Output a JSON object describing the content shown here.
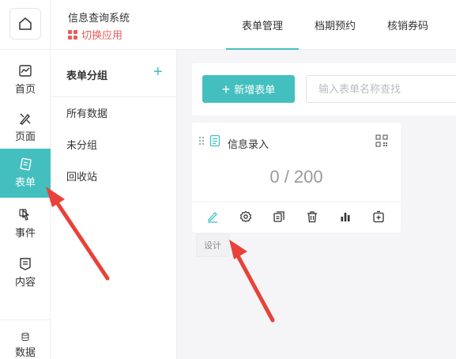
{
  "rail": {
    "items": [
      {
        "label": "首页",
        "icon": "chart-icon"
      },
      {
        "label": "页面",
        "icon": "brush-icon"
      },
      {
        "label": "表单",
        "icon": "form-icon",
        "active": true
      },
      {
        "label": "事件",
        "icon": "pointer-icon"
      },
      {
        "label": "内容",
        "icon": "content-icon"
      },
      {
        "label": "数据",
        "icon": "database-icon"
      }
    ]
  },
  "header": {
    "app_title": "信息查询系统",
    "switch_app": "切换应用",
    "tabs": [
      {
        "label": "表单管理",
        "active": true
      },
      {
        "label": "档期预约"
      },
      {
        "label": "核销券码"
      }
    ]
  },
  "groups": {
    "title": "表单分组",
    "add_symbol": "+",
    "items": [
      "所有数据",
      "未分组",
      "回收站"
    ]
  },
  "toolbar": {
    "new_form_label": "新增表单",
    "search_placeholder": "输入表单名称查找"
  },
  "card": {
    "title": "信息录入",
    "count": "0 / 200",
    "tooltip": "设计",
    "actions": [
      "edit-icon",
      "settings-icon",
      "copy-icon",
      "delete-icon",
      "stats-icon",
      "add-icon"
    ]
  },
  "colors": {
    "accent": "#44bfbf",
    "switch": "#ea5b5b",
    "arrow": "#e8423a"
  }
}
